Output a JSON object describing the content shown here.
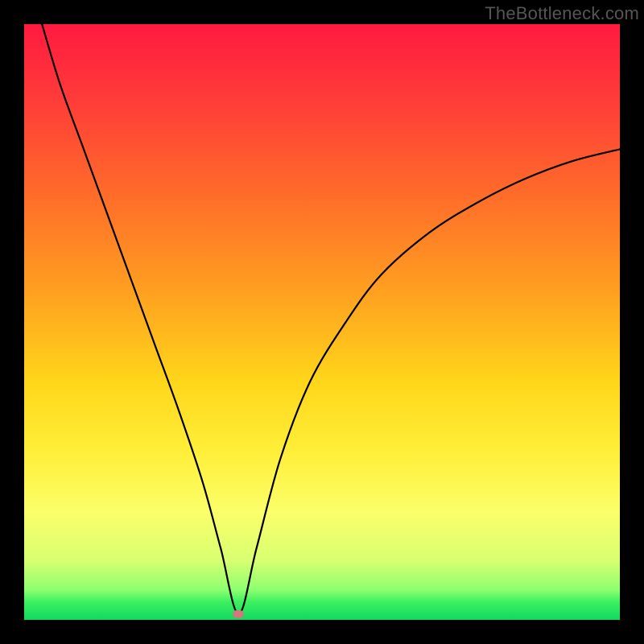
{
  "watermark": "TheBottleneck.com",
  "chart_data": {
    "type": "line",
    "title": "",
    "xlabel": "",
    "ylabel": "",
    "xlim": [
      0,
      100
    ],
    "ylim": [
      0,
      100
    ],
    "grid": false,
    "annotations": {
      "marker": {
        "x": 36,
        "y": 1
      }
    },
    "series": [
      {
        "name": "curve",
        "x": [
          3,
          6,
          10,
          14,
          18,
          22,
          26,
          30,
          33,
          36,
          39,
          43,
          48,
          54,
          60,
          68,
          76,
          84,
          92,
          100
        ],
        "values": [
          100,
          90,
          79,
          68,
          57,
          46,
          35,
          23,
          12,
          1,
          12,
          27,
          40,
          50,
          58,
          65,
          70,
          74,
          77,
          79
        ]
      }
    ],
    "gradient_colors": {
      "top": "#ff1a40",
      "mid": "#ffd61a",
      "bottom": "#12d860"
    }
  }
}
